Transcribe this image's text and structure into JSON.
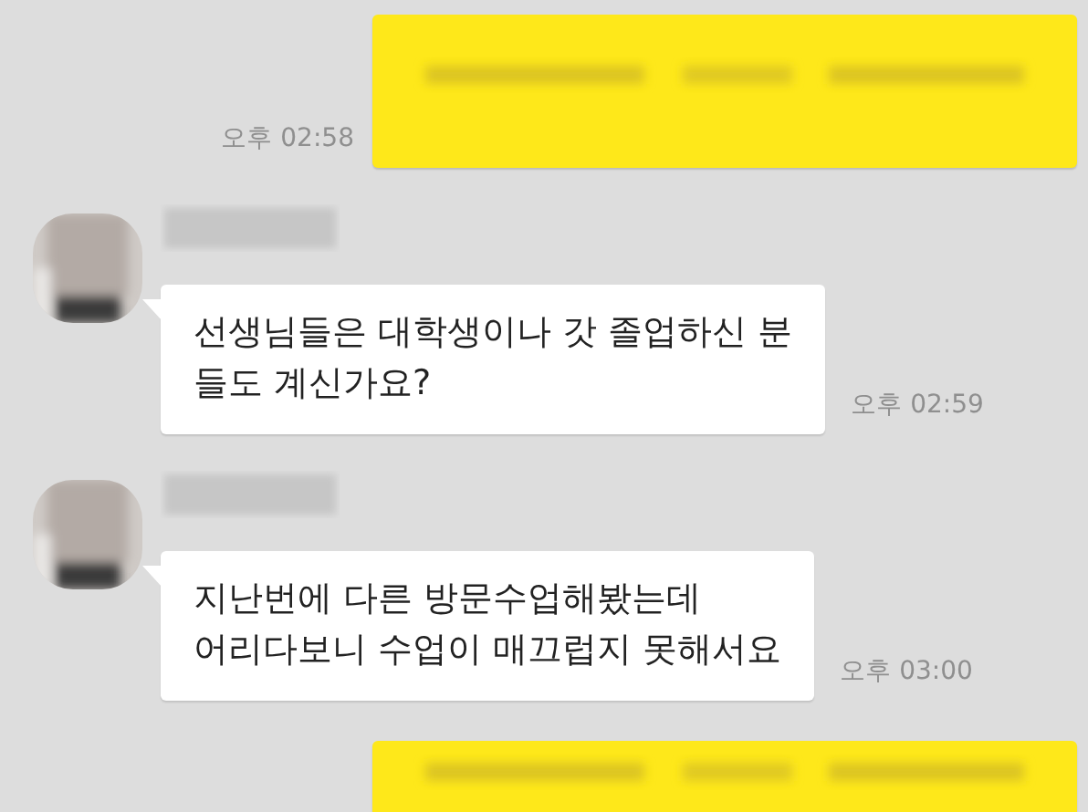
{
  "messages": [
    {
      "kind": "sent",
      "time": "오후 02:58"
    },
    {
      "kind": "received",
      "lines": [
        "선생님들은 대학생이나 갓 졸업하신 분",
        "들도 계신가요?"
      ],
      "time": "오후 02:59"
    },
    {
      "kind": "received",
      "lines": [
        "지난번에 다른 방문수업해봤는데",
        "어리다보니 수업이 매끄럽지 못해서요"
      ],
      "time": "오후 03:00"
    },
    {
      "kind": "sent"
    }
  ]
}
